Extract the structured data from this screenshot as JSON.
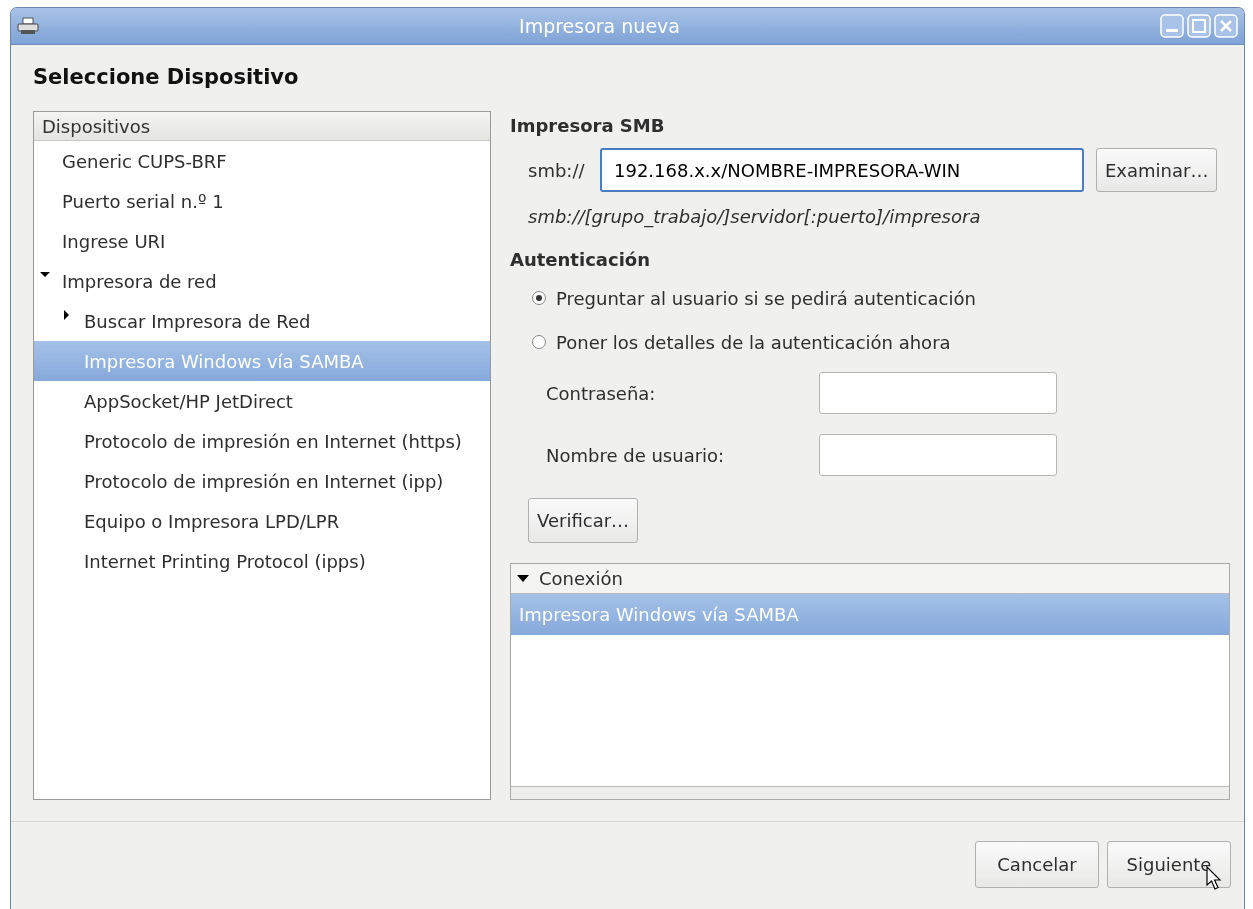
{
  "window": {
    "title": "Impresora nueva"
  },
  "heading": "Seleccione Dispositivo",
  "devices": {
    "header": "Dispositivos",
    "items": [
      {
        "label": "Generic CUPS-BRF",
        "selected": false
      },
      {
        "label": "Puerto serial n.º 1",
        "selected": false
      },
      {
        "label": "Ingrese URI",
        "selected": false
      },
      {
        "label": "Impresora de red",
        "selected": false,
        "expanded": true,
        "children": [
          {
            "label": "Buscar Impresora de Red",
            "selected": false,
            "expanded": false
          },
          {
            "label": "Impresora Windows vía SAMBA",
            "selected": true
          },
          {
            "label": "AppSocket/HP JetDirect",
            "selected": false
          },
          {
            "label": "Protocolo de impresión en Internet (https)",
            "selected": false
          },
          {
            "label": "Protocolo de impresión en Internet (ipp)",
            "selected": false
          },
          {
            "label": "Equipo o Impresora LPD/LPR",
            "selected": false
          },
          {
            "label": "Internet Printing Protocol (ipps)",
            "selected": false
          }
        ]
      }
    ]
  },
  "smb": {
    "title": "Impresora SMB",
    "prefix": "smb://",
    "uri_value": "192.168.x.x/NOMBRE-IMPRESORA-WIN",
    "browse_button": "Examinar…",
    "hint": "smb://[grupo_trabajo/]servidor[:puerto]/impresora"
  },
  "authentication": {
    "title": "Autenticación",
    "options": [
      {
        "label": "Preguntar al usuario si se pedirá autenticación",
        "selected": true
      },
      {
        "label": "Poner los detalles de la autenticación ahora",
        "selected": false
      }
    ],
    "fields": [
      {
        "label": "Contraseña:"
      },
      {
        "label": "Nombre de usuario:"
      }
    ],
    "verify_button": "Verificar…"
  },
  "connection": {
    "header": "Conexión",
    "expanded": true,
    "rows": [
      {
        "label": "Impresora Windows vía SAMBA",
        "selected": true
      }
    ]
  },
  "buttons": [
    "Cancelar",
    "Siguiente"
  ]
}
